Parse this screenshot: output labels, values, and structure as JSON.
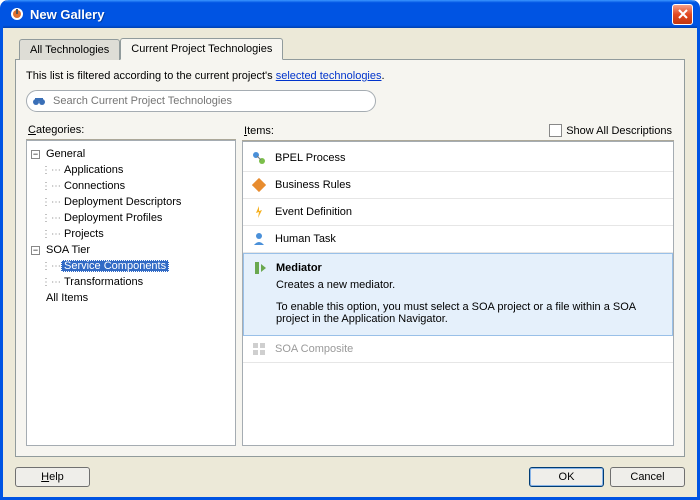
{
  "window": {
    "title": "New Gallery"
  },
  "tabs": {
    "all": "All Technologies",
    "current": "Current Project Technologies"
  },
  "filter": {
    "text_prefix": "This list is filtered according to the current project's ",
    "link": "selected technologies",
    "text_suffix": "."
  },
  "search": {
    "placeholder": "Search Current Project Technologies"
  },
  "categories": {
    "header": "Categories:",
    "root1": "General",
    "root1_children": [
      "Applications",
      "Connections",
      "Deployment Descriptors",
      "Deployment Profiles",
      "Projects"
    ],
    "root2": "SOA Tier",
    "root2_children": [
      "Service Components",
      "Transformations"
    ],
    "root3": "All Items",
    "selected": "Service Components"
  },
  "items": {
    "header": "Items:",
    "show_all": "Show All Descriptions",
    "list": [
      {
        "name": "BPEL Process",
        "icon": "bpel",
        "state": "normal"
      },
      {
        "name": "Business Rules",
        "icon": "rules",
        "state": "normal"
      },
      {
        "name": "Event Definition",
        "icon": "event",
        "state": "normal"
      },
      {
        "name": "Human Task",
        "icon": "human",
        "state": "normal"
      },
      {
        "name": "Mediator",
        "icon": "mediator",
        "state": "selected",
        "desc": "Creates a new mediator.",
        "note": "To enable this option, you must select a SOA project or a file within a SOA project in the Application Navigator."
      },
      {
        "name": "SOA Composite",
        "icon": "composite",
        "state": "disabled"
      }
    ]
  },
  "buttons": {
    "help": "Help",
    "ok": "OK",
    "cancel": "Cancel"
  }
}
